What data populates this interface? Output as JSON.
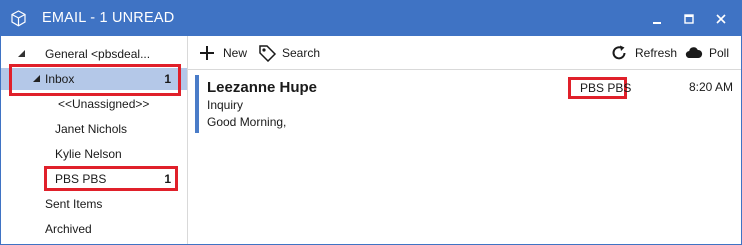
{
  "window": {
    "title": "EMAIL - 1 UNREAD",
    "accent_color": "#3f73c4",
    "icon": "cube-icon",
    "controls": [
      "minimize-icon",
      "maximize-icon",
      "close-icon"
    ]
  },
  "sidebar": {
    "account_label": "General  <pbsdeal...",
    "items": [
      {
        "label": "Inbox",
        "count": "1"
      },
      {
        "label": "<<Unassigned>>"
      },
      {
        "label": "Janet Nichols"
      },
      {
        "label": "Kylie Nelson"
      },
      {
        "label": "PBS PBS",
        "count": "1"
      },
      {
        "label": "Sent Items"
      },
      {
        "label": "Archived"
      }
    ]
  },
  "toolbar": {
    "new_label": "New",
    "search_label": "Search",
    "refresh_label": "Refresh",
    "poll_label": "Poll",
    "icons": [
      "plus-icon",
      "tag-icon",
      "refresh-icon",
      "cloud-icon"
    ]
  },
  "messages": [
    {
      "from": "Leezanne Hupe",
      "subject": "Inquiry",
      "preview": "Good Morning,",
      "tag": "PBS PBS",
      "time": "8:20 AM"
    }
  ],
  "highlight_color": "#e0202a",
  "selection_color": "#b4c8e8"
}
